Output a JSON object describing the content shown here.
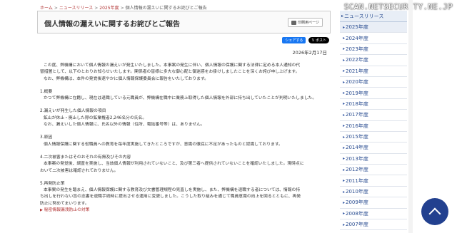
{
  "watermark": "SCAN.NETSECURITY.NE.JP",
  "breadcrumb": {
    "home": "ホーム",
    "news": "ニュースリリース",
    "year": "2025年度",
    "current": "個人情報の漏えいに関するお詫びとご報告"
  },
  "page": {
    "title": "個人情報の漏えいに関するお詫びとご報告",
    "print_label": "印刷用ページ",
    "share_label": "シェアする",
    "post_label": "ポスト",
    "date": "2026年2月17日"
  },
  "body": {
    "intro_1": "この度、弊機構において個人情報の漏えいが発生いたしました。本事案の発生に伴い、個人情報の保護に関する法律に定める本人通知の代",
    "intro_2": "替措置として、以下のとおりお知らせいたします。関係者の皆様に多大な御心配と御迷惑をお掛けしましたことを深くお詫び申し上げます。",
    "intro_3": "なお、弊機構は、本件の発覚後速やかに個人情報保護委員会に報告をいたしております。",
    "s1_head": "1.概要",
    "s1_text": "かつて弊機構に在籍し、現在は退職している元職員が、弊機構在職中に業務上取得した個人情報を外部に持ち出していたことが判明いたしました。",
    "s2_head": "2.漏えいが発生した個人情報の項目",
    "s2_text1": "鉱山が休止・廃止した際の鉱業権者2,246名分の氏名。",
    "s2_text2": "なお、漏えいした個人情報に、氏名以外の情報（住所、電話番号等）は、ありません。",
    "s3_head": "3.原因",
    "s3_text": "個人情報保護に関する役職員への教育を毎年度実施してきたところですが、意識の徹底に不足があったものと認識しております。",
    "s4_head": "4.二次被害またはそのおそれの有無及びその内容",
    "s4_text1": "本事案の発覚後、調査を実施し、当該個人情報が利用されていないこと、及び第三者へ提供されていないことを確認いたしました。現時点に",
    "s4_text2": "おいて二次被害は確認されておりません。",
    "s5_head": "5.再発防止策",
    "s5_text1": "本事案の発生を踏まえ、個人情報保護に関する教育及び文書管理規程の見直しを実施し、また、弊機構を退職する者については、情報の持",
    "s5_text2": "ち出しを行わない旨の念書を退職手続時に提出させる運用に変更しました。こうした取り組みを通じて職員意識の向上を図るとともに、再発",
    "s5_text3": "防止に努めてまいります。",
    "link": "秘密情報漏洩防止の対策"
  },
  "sidebar": {
    "heading": "ニュースリリース",
    "items": [
      "2025年度",
      "2024年度",
      "2023年度",
      "2022年度",
      "2021年度",
      "2020年度",
      "2019年度",
      "2018年度",
      "2017年度",
      "2016年度",
      "2015年度",
      "2014年度",
      "2013年度",
      "2012年度",
      "2011年度",
      "2010年度",
      "2009年度",
      "2008年度",
      "2007年度"
    ],
    "active_index": 0
  },
  "colors": {
    "link_red": "#b03030",
    "sidebar_blue": "#2a4d91",
    "top_button": "#22408f"
  }
}
